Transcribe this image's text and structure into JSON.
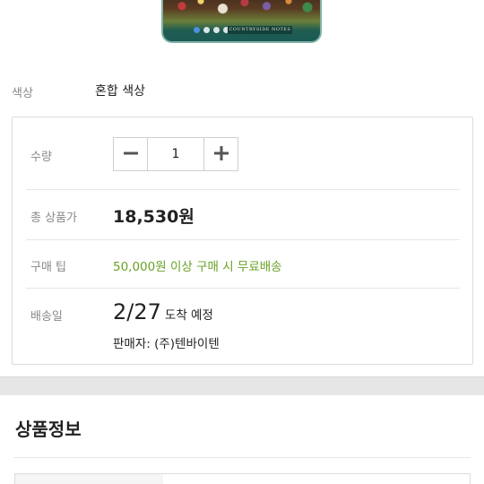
{
  "product_image": {
    "banner_text": "COUNTRYSIDE NOTES",
    "slide_count": 7,
    "active_slide": 1
  },
  "options": {
    "color_label": "색상",
    "color_value": "혼합 색상"
  },
  "quantity": {
    "label": "수량",
    "value": "1",
    "minus_symbol": "−",
    "plus_symbol": "+"
  },
  "price": {
    "label": "총 상품가",
    "value": "18,530원"
  },
  "tip": {
    "label": "구매 팁",
    "value": "50,000원 이상 구매 시 무료배송"
  },
  "shipping": {
    "label": "배송일",
    "date": "2/27",
    "date_suffix": "도착 예정",
    "seller": "판매자: (주)텐바이텐"
  },
  "product_info": {
    "title": "상품정보"
  },
  "colors": {
    "tip_green": "#6aa127",
    "active_dot": "#4a90e2"
  }
}
